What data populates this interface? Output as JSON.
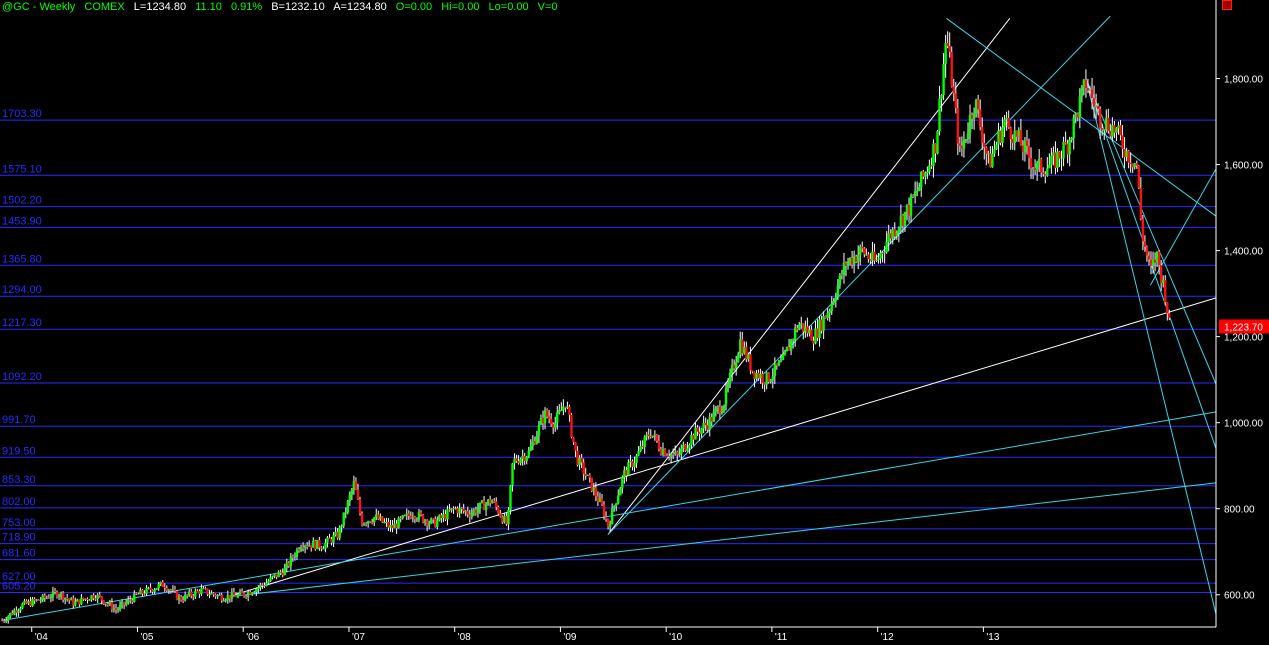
{
  "header": {
    "symbol": "@GC - Weekly",
    "exchange": "COMEX",
    "last": "L=1234.80",
    "change": "11.10",
    "change_pct": "0.91%",
    "bid": "B=1232.10",
    "ask": "A=1234.80",
    "open": "O=0.00",
    "high": "Hi=0.00",
    "low": "Lo=0.00",
    "volume": "V=0"
  },
  "colors": {
    "background": "#000000",
    "up_bar": "#00ff00",
    "down_bar": "#ff1010",
    "wick": "#ffffff",
    "level_line": "#2a2aff",
    "fan_white": "#ffffff",
    "fan_cyan": "#36d6e6",
    "last_price_tag": "#ff0000"
  },
  "chart_data": {
    "type": "candlestick",
    "instrument": "@GC Weekly (COMEX Gold)",
    "y_axis": {
      "ticks": [
        600,
        800,
        1000,
        1200,
        1400,
        1600,
        1800
      ],
      "tick_labels": [
        "600.00",
        "800.00",
        "1,000.00",
        "1,200.00",
        "1,400.00",
        "1,600.00",
        "1,800.00"
      ],
      "ylim": [
        525,
        1950
      ]
    },
    "x_axis": {
      "labels": [
        "'04",
        "'05",
        "'06",
        "'07",
        "'08",
        "'09",
        "'10",
        "'11",
        "'12",
        "'13"
      ],
      "xlim": [
        2003.7,
        2015.2
      ]
    },
    "last_price_tag": "1,223.70",
    "horizontal_levels": [
      {
        "value": 1703.3,
        "label": "1703.30"
      },
      {
        "value": 1575.1,
        "label": "1575.10"
      },
      {
        "value": 1502.2,
        "label": "1502.20"
      },
      {
        "value": 1453.9,
        "label": "1453.90"
      },
      {
        "value": 1365.8,
        "label": "1365.80"
      },
      {
        "value": 1294.0,
        "label": "1294.00"
      },
      {
        "value": 1217.3,
        "label": "1217.30"
      },
      {
        "value": 1092.2,
        "label": "1092.20"
      },
      {
        "value": 991.7,
        "label": "991.70"
      },
      {
        "value": 919.5,
        "label": "919.50"
      },
      {
        "value": 853.3,
        "label": "853.30"
      },
      {
        "value": 802.0,
        "label": "802.00"
      },
      {
        "value": 753.0,
        "label": "753.00"
      },
      {
        "value": 718.9,
        "label": "718.90"
      },
      {
        "value": 681.6,
        "label": "681.60"
      },
      {
        "value": 627.0,
        "label": "627.00"
      },
      {
        "value": 605.2,
        "label": "605.20"
      }
    ],
    "price_path": [
      [
        2003.72,
        540
      ],
      [
        2003.9,
        575
      ],
      [
        2004.1,
        590
      ],
      [
        2004.25,
        605
      ],
      [
        2004.4,
        580
      ],
      [
        2004.6,
        600
      ],
      [
        2004.8,
        565
      ],
      [
        2005.0,
        600
      ],
      [
        2005.25,
        625
      ],
      [
        2005.4,
        590
      ],
      [
        2005.6,
        610
      ],
      [
        2005.8,
        595
      ],
      [
        2006.0,
        600
      ],
      [
        2006.2,
        625
      ],
      [
        2006.4,
        660
      ],
      [
        2006.55,
        720
      ],
      [
        2006.75,
        715
      ],
      [
        2006.9,
        740
      ],
      [
        2007.05,
        860
      ],
      [
        2007.12,
        770
      ],
      [
        2007.25,
        780
      ],
      [
        2007.4,
        755
      ],
      [
        2007.6,
        790
      ],
      [
        2007.8,
        765
      ],
      [
        2008.0,
        800
      ],
      [
        2008.15,
        790
      ],
      [
        2008.35,
        820
      ],
      [
        2008.5,
        760
      ],
      [
        2008.55,
        910
      ],
      [
        2008.7,
        930
      ],
      [
        2008.85,
        1020
      ],
      [
        2008.95,
        1000
      ],
      [
        2009.05,
        1050
      ],
      [
        2009.15,
        920
      ],
      [
        2009.3,
        850
      ],
      [
        2009.4,
        800
      ],
      [
        2009.45,
        760
      ],
      [
        2009.6,
        880
      ],
      [
        2009.72,
        920
      ],
      [
        2009.85,
        980
      ],
      [
        2009.95,
        940
      ],
      [
        2010.1,
        920
      ],
      [
        2010.25,
        970
      ],
      [
        2010.4,
        1000
      ],
      [
        2010.55,
        1050
      ],
      [
        2010.7,
        1190
      ],
      [
        2010.82,
        1120
      ],
      [
        2010.95,
        1100
      ],
      [
        2011.1,
        1140
      ],
      [
        2011.25,
        1230
      ],
      [
        2011.4,
        1200
      ],
      [
        2011.55,
        1270
      ],
      [
        2011.7,
        1370
      ],
      [
        2011.85,
        1400
      ],
      [
        2011.98,
        1370
      ],
      [
        2012.1,
        1430
      ],
      [
        2012.3,
        1500
      ],
      [
        2012.45,
        1580
      ],
      [
        2012.55,
        1650
      ],
      [
        2012.65,
        1900
      ],
      [
        2012.7,
        1800
      ],
      [
        2012.78,
        1620
      ],
      [
        2012.92,
        1750
      ],
      [
        2013.05,
        1600
      ],
      [
        2013.2,
        1700
      ],
      [
        2013.35,
        1650
      ],
      [
        2013.5,
        1590
      ],
      [
        2013.65,
        1600
      ],
      [
        2013.8,
        1650
      ],
      [
        2013.97,
        1790
      ],
      [
        2014.1,
        1710
      ],
      [
        2014.25,
        1680
      ],
      [
        2014.35,
        1630
      ],
      [
        2014.45,
        1600
      ],
      [
        2014.5,
        1440
      ],
      [
        2014.58,
        1350
      ],
      [
        2014.64,
        1390
      ],
      [
        2014.72,
        1300
      ],
      [
        2014.76,
        1223.7
      ]
    ],
    "trendlines": [
      {
        "color": "white",
        "from": [
          2005.85,
          595
        ],
        "to": [
          2015.2,
          1290
        ]
      },
      {
        "color": "white",
        "from": [
          2009.45,
          740
        ],
        "to": [
          2013.25,
          1940
        ]
      },
      {
        "color": "cyan",
        "from": [
          2009.45,
          740
        ],
        "to": [
          2014.2,
          1945
        ]
      },
      {
        "color": "cyan",
        "from": [
          2003.72,
          540
        ],
        "to": [
          2015.2,
          1025
        ]
      },
      {
        "color": "cyan",
        "from": [
          2005.85,
          595
        ],
        "to": [
          2015.2,
          860
        ]
      },
      {
        "color": "cyan",
        "from": [
          2012.65,
          1940
        ],
        "to": [
          2015.2,
          1480
        ]
      },
      {
        "color": "cyan",
        "from": [
          2013.97,
          1800
        ],
        "to": [
          2015.2,
          555
        ]
      },
      {
        "color": "cyan",
        "from": [
          2013.97,
          1800
        ],
        "to": [
          2015.2,
          940
        ]
      },
      {
        "color": "cyan",
        "from": [
          2013.97,
          1800
        ],
        "to": [
          2015.2,
          1090
        ]
      },
      {
        "color": "cyan",
        "from": [
          2014.58,
          1320
        ],
        "to": [
          2015.2,
          1590
        ]
      }
    ]
  }
}
